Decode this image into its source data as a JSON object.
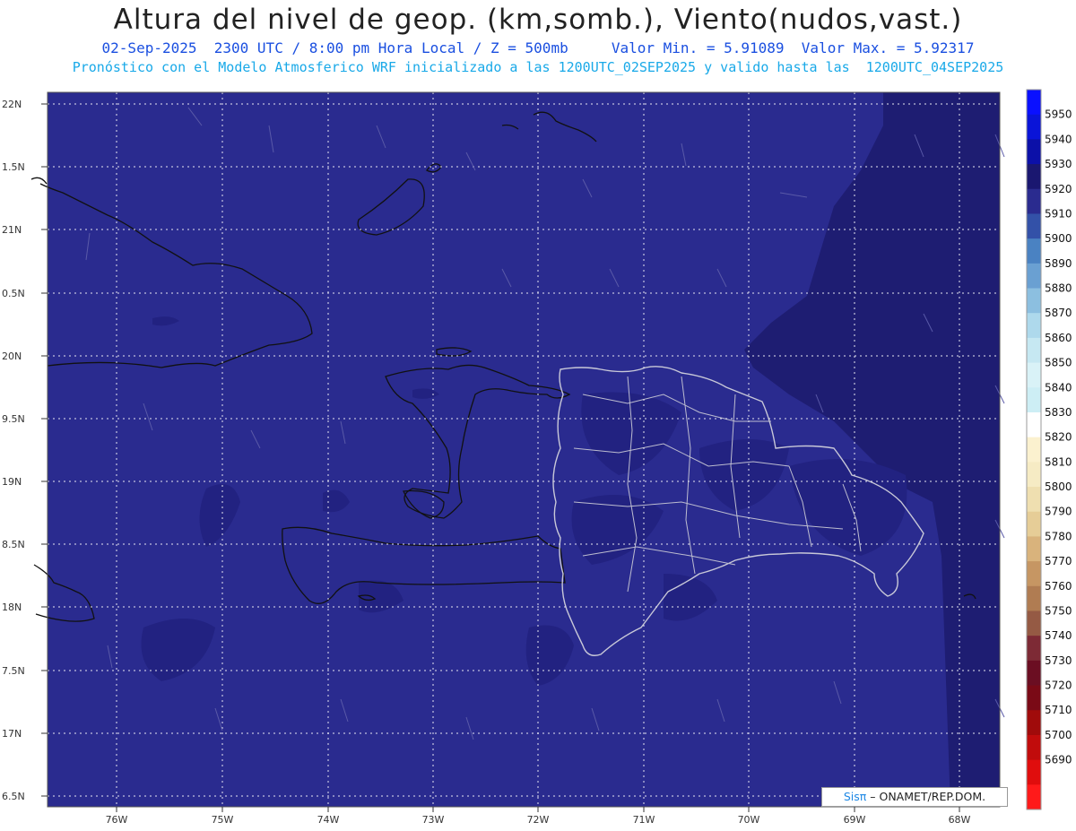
{
  "header": {
    "title": "Altura del nivel de geop. (km,somb.), Viento(nudos,vast.)",
    "line1": "02-Sep-2025  2300 UTC / 8:00 pm Hora Local / Z = 500mb     Valor Min. = 5.91089  Valor Max. = 5.92317",
    "line2": "Pronóstico con el Modelo Atmosferico WRF inicializado a las 1200UTC_02SEP2025 y valido hasta las  1200UTC_04SEP2025"
  },
  "map": {
    "lat_labels": [
      "22N",
      "1.5N",
      "21N",
      "0.5N",
      "20N",
      "9.5N",
      "19N",
      "8.5N",
      "18N",
      "7.5N",
      "17N",
      "6.5N"
    ],
    "lon_labels": [
      "76W",
      "75W",
      "74W",
      "73W",
      "72W",
      "71W",
      "70W",
      "69W",
      "68W"
    ],
    "colors": {
      "base": "#2a2b8f",
      "darker": "#1e1d72",
      "coast": "#111111",
      "borders": "#c8c8d8",
      "grid": "#e6e6f0"
    }
  },
  "colorbar": {
    "labels": [
      "5950",
      "5940",
      "5930",
      "5920",
      "5910",
      "5900",
      "5890",
      "5880",
      "5870",
      "5860",
      "5850",
      "5840",
      "5830",
      "5820",
      "5810",
      "5800",
      "5790",
      "5780",
      "5770",
      "5760",
      "5750",
      "5740",
      "5730",
      "5720",
      "5710",
      "5700",
      "5690"
    ],
    "colors": [
      "#0a10ff",
      "#0a14d8",
      "#0c10a8",
      "#1a1770",
      "#2a2b8f",
      "#3351a8",
      "#4a82c2",
      "#6aa0d2",
      "#8cbfe0",
      "#aed9ec",
      "#c6e8f2",
      "#d9f2f7",
      "#cdeef5",
      "#ffffff",
      "#fbf1cf",
      "#f6ebc4",
      "#efdfb0",
      "#e6cd97",
      "#d9b37c",
      "#c69663",
      "#b07c52",
      "#955a44",
      "#7d2a35",
      "#6b0e22",
      "#7a0a16",
      "#a00b0b",
      "#c10c0c",
      "#e00d0d",
      "#ff1a1a"
    ]
  },
  "credit": {
    "brand": "Sisπ",
    "text": " – ONAMET/REP.DOM."
  }
}
